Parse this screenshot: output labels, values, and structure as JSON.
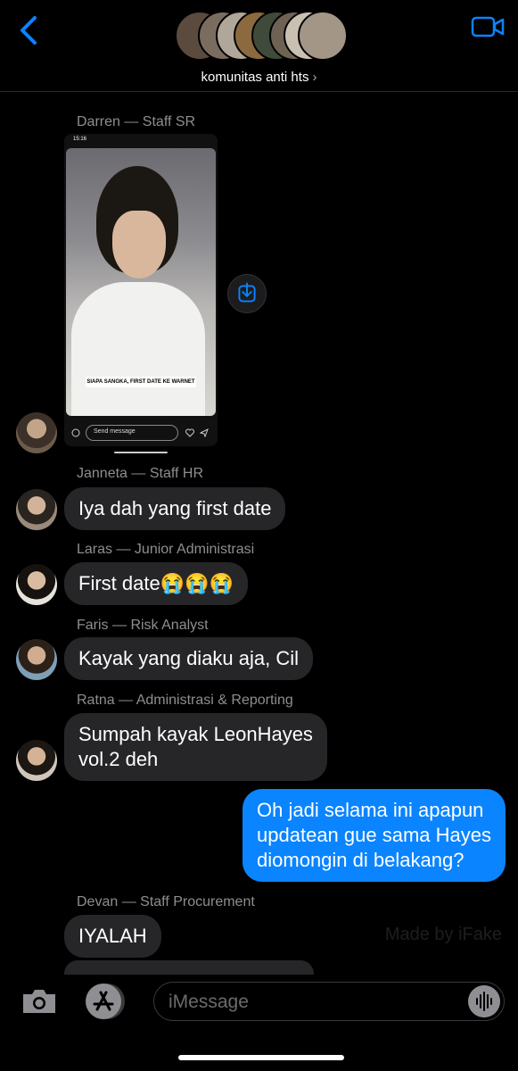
{
  "header": {
    "group_name": "komunitas anti hts",
    "chevron": "›"
  },
  "image_message": {
    "sender": "Darren — Staff SR",
    "status_time": "15:16",
    "caption": "SIAPA SANGKA, FIRST DATE KE WARNET",
    "send_placeholder": "Send message"
  },
  "messages": [
    {
      "sender": "Janneta — Staff HR",
      "text": "Iya dah yang first date"
    },
    {
      "sender": "Laras — Junior Administrasi",
      "text": "First date😭😭😭"
    },
    {
      "sender": "Faris — Risk Analyst",
      "text": "Kayak yang diaku aja, Cil"
    },
    {
      "sender": "Ratna — Administrasi & Reporting",
      "line1": "Sumpah kayak LeonHayes",
      "line2": "vol.2 deh"
    }
  ],
  "my_message": {
    "line1": "Oh jadi selama ini apapun",
    "line2": "updatean gue sama Hayes",
    "line3": "diomongin di belakang?"
  },
  "last": {
    "sender": "Devan — Staff Procurement",
    "text": "IYALAH"
  },
  "watermark": "Made by iFake",
  "composer": {
    "placeholder": "iMessage"
  },
  "colors": {
    "accent": "#0a84ff",
    "bubble_gray": "#262628",
    "background": "#000000"
  }
}
